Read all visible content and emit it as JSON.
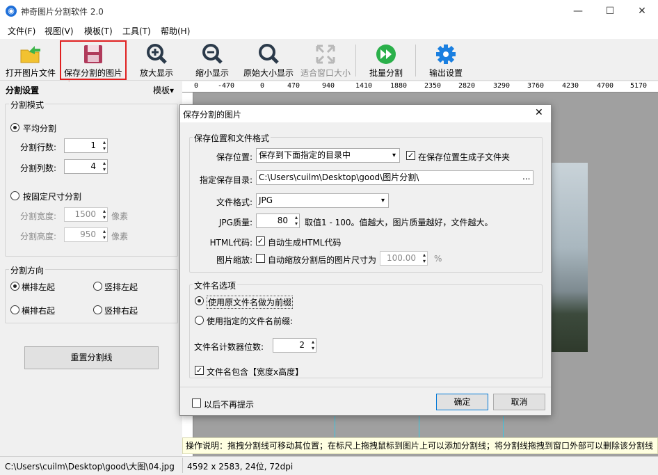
{
  "window": {
    "title": "神奇图片分割软件 2.0",
    "minimize": "—",
    "maximize": "☐",
    "close": "✕"
  },
  "menu": [
    "文件(F)",
    "视图(V)",
    "模板(T)",
    "工具(T)",
    "帮助(H)"
  ],
  "toolbar": {
    "open": "打开图片文件",
    "save": "保存分割的图片",
    "zoom_in": "放大显示",
    "zoom_out": "缩小显示",
    "original": "原始大小显示",
    "fit": "适合窗口大小",
    "batch": "批量分割",
    "output": "输出设置"
  },
  "left": {
    "header": "分割设置",
    "template": "模板▾",
    "mode_group": "分割模式",
    "even_split": "平均分割",
    "rows_label": "分割行数:",
    "rows": "1",
    "cols_label": "分割列数:",
    "cols": "4",
    "fixed_split": "按固定尺寸分割",
    "width_label": "分割宽度:",
    "width": "1500",
    "height_label": "分割高度:",
    "height": "950",
    "unit": "像素",
    "dir_group": "分割方向",
    "h_left": "横排左起",
    "v_left": "竖排左起",
    "h_right": "横排右起",
    "v_right": "竖排右起",
    "reset": "重置分割线"
  },
  "ruler": [
    "0",
    "-470",
    "0",
    "470",
    "940",
    "1410",
    "1880",
    "2350",
    "2820",
    "3290",
    "3760",
    "4230",
    "4700",
    "5170"
  ],
  "hint": "操作说明：拖拽分割线可移动其位置；在标尺上拖拽鼠标到图片上可以添加分割线；将分割线拖拽到窗口外部可以删除该分割线",
  "status": {
    "path": "C:\\Users\\cuilm\\Desktop\\good\\大图\\04.jpg",
    "info": "4592 x 2583, 24位, 72dpi"
  },
  "dialog": {
    "title": "保存分割的图片",
    "close": "✕",
    "loc_group": "保存位置和文件格式",
    "save_loc_label": "保存位置:",
    "save_loc": "保存到下面指定的目录中",
    "subfolder": "在保存位置生成子文件夹",
    "dir_label": "指定保存目录:",
    "dir": "C:\\Users\\cuilm\\Desktop\\good\\图片分割\\",
    "browse": "...",
    "format_label": "文件格式:",
    "format": "JPG",
    "quality_label": "JPG质量:",
    "quality": "80",
    "quality_hint": "取值1 - 100。值越大，图片质量越好，文件越大。",
    "html_label": "HTML代码:",
    "html": "自动生成HTML代码",
    "scale_label": "图片缩放:",
    "scale": "自动缩放分割后的图片尺寸为",
    "scale_value": "100.00",
    "percent": "%",
    "name_group": "文件名选项",
    "use_orig": "使用原文件名做为前缀",
    "use_custom": "使用指定的文件名前缀:",
    "digits_label": "文件名计数器位数:",
    "digits": "2",
    "include_size": "文件名包含【宽度x高度】",
    "no_prompt": "以后不再提示",
    "ok": "确定",
    "cancel": "取消"
  },
  "colors": {
    "accent_red": "#e02020",
    "hint_bg": "#ffffe1"
  }
}
